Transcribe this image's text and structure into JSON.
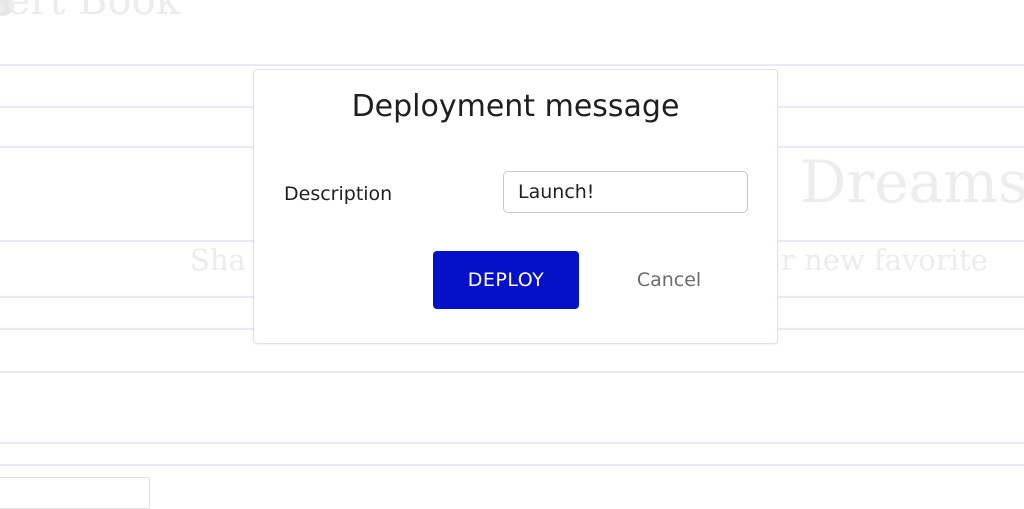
{
  "background": {
    "top_title": "sert Book",
    "hero_text": "Dreams",
    "subtitle_left": "Sha",
    "subtitle_right": "r new favorite"
  },
  "modal": {
    "title": "Deployment message",
    "description_label": "Description",
    "description_value": "Launch!",
    "deploy_label": "DEPLOY",
    "cancel_label": "Cancel"
  },
  "colors": {
    "primary_button": "#0511c8",
    "cancel_text": "#6d6d6d",
    "background_rule": "#e9eaf7"
  }
}
